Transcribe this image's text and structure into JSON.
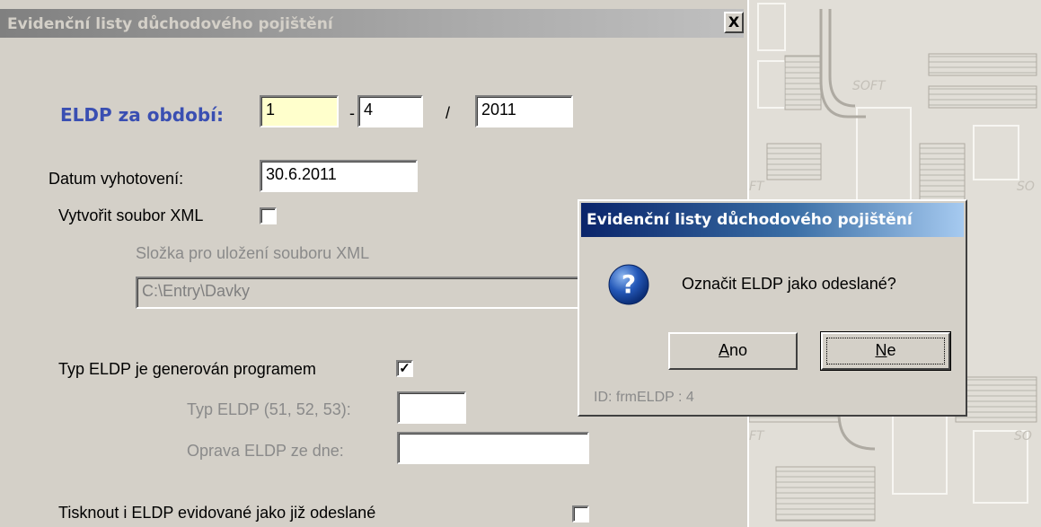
{
  "main": {
    "title": "Evidenční listy důchodového pojištění",
    "close_label": "X",
    "period_label": "ELDP za období:",
    "period_from": "1",
    "period_dash": "-",
    "period_to": "4",
    "period_slash": "/",
    "period_year": "2011",
    "date_label": "Datum vyhotovení:",
    "date_value": "30.6.2011",
    "xml_label": "Vytvořit soubor XML",
    "xml_checked": false,
    "folder_label": "Složka pro uložení souboru XML",
    "folder_value": "C:\\Entry\\Davky",
    "generated_label": "Typ ELDP je generován programem",
    "generated_check": "✓",
    "type_label": "Typ ELDP (51, 52, 53):",
    "type_value": "",
    "fix_label": "Oprava ELDP ze dne:",
    "fix_value": "",
    "print_label": "Tisknout i ELDP evidované jako již odeslané"
  },
  "dialog": {
    "title": "Evidenční listy důchodového pojištění",
    "icon": "question-icon",
    "message": "Označit ELDP jako odeslané?",
    "yes_first": "A",
    "yes_rest": "no",
    "no_first": "N",
    "no_rest": "e",
    "id_text": "ID: frmELDP : 4"
  },
  "colors": {
    "accent_blue": "#3a4fb2",
    "dialog_title_start": "#0a246a",
    "dialog_title_end": "#a6caf0",
    "window_bg": "#d4d0c8"
  }
}
